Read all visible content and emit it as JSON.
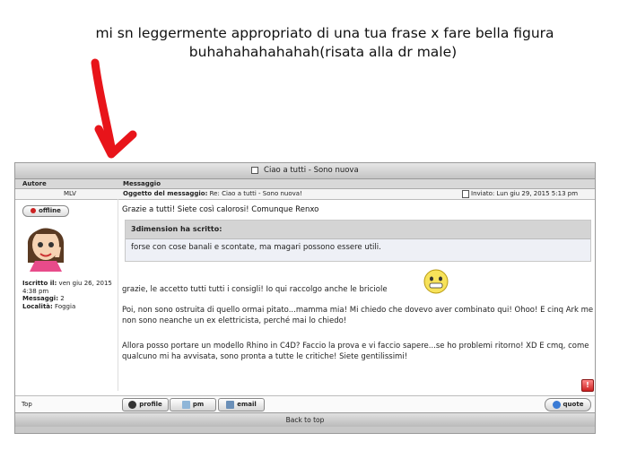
{
  "caption": {
    "line1": "mi sn leggermente appropriato di una tua frase x fare bella figura",
    "line2": "buhahahahahahah(risata alla dr male)"
  },
  "forum": {
    "topic_title": "Ciao a tutti - Sono nuova",
    "columns": {
      "author": "Autore",
      "message": "Messaggio"
    },
    "post": {
      "author": "MLV",
      "subject_label": "Oggetto del messaggio:",
      "subject": "Re: Ciao a tutti - Sono nuova!",
      "date": "Inviato: Lun giu 29, 2015 5:13 pm",
      "status": "offline",
      "user_info": {
        "joined_label": "Iscritto il:",
        "joined": "ven giu 26, 2015 4:38 pm",
        "messages_label": "Messaggi:",
        "messages": "2",
        "location_label": "Località:",
        "location": "Foggia"
      },
      "greeting": "Grazie a tutti! Siete così calorosi! Comunque Renxo",
      "quote": {
        "header": "3dimension ha scritto:",
        "body": "forse con cose banali e scontate, ma magari possono essere utili."
      },
      "paragraph2": "grazie, le accetto tutti tutti i consigli! Io qui raccolgo anche le briciole",
      "paragraph3": "Poi, non sono ostruita di quello ormai pitato...mamma mia! Mi chiedo che dovevo aver combinato qui! Ohoo! E cinq Ark me non sono neanche un ex elettricista, perché mai lo chiedo!",
      "paragraph4": "Allora posso portare un modello Rhino in C4D? Faccio la prova e vi faccio sapere...se ho problemi ritorno! XD E cmq, come qualcuno mi ha avvisata, sono pronta a tutte le critiche! Siete gentilissimi!"
    },
    "buttons": {
      "top": "Top",
      "profile": "profile",
      "pm": "pm",
      "email": "email",
      "quote": "quote",
      "report": "!"
    },
    "back_to_top": "Back to top"
  },
  "colors": {
    "arrow": "#e8141a",
    "offline": "#cc2222",
    "header_gray": "#c8c8c8"
  },
  "icons": [
    "red-arrow-icon",
    "offline-icon",
    "smiley-icon",
    "profile-icon",
    "pm-icon",
    "email-icon",
    "quote-icon",
    "report-icon"
  ]
}
